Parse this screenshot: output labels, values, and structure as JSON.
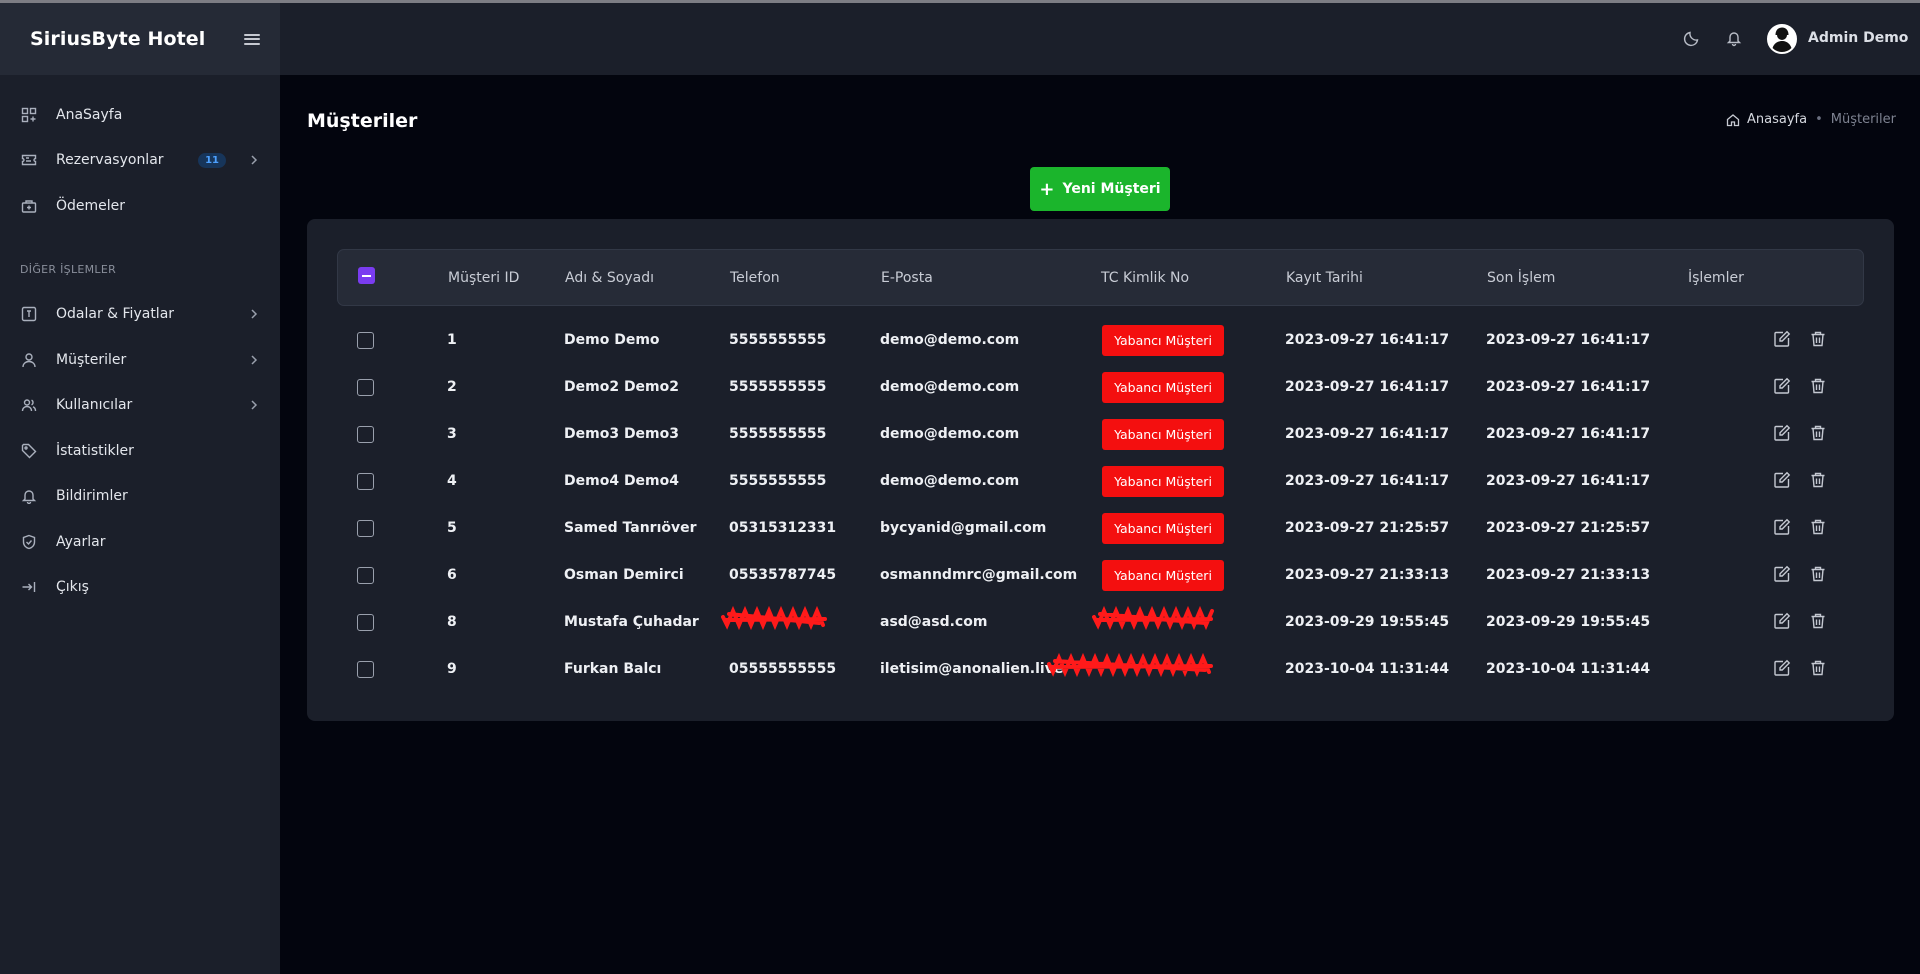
{
  "app": {
    "brand": "SiriusByte Hotel"
  },
  "sidebar": {
    "main_items": [
      {
        "label": "AnaSayfa",
        "icon": "dashboard-icon"
      },
      {
        "label": "Rezervasyonlar",
        "icon": "ticket-icon",
        "badge": "11",
        "has_submenu": true
      },
      {
        "label": "Ödemeler",
        "icon": "wallet-icon"
      }
    ],
    "section_title": "DİĞER İŞLEMLER",
    "other_items": [
      {
        "label": "Odalar & Fiyatlar",
        "icon": "room-icon",
        "has_submenu": true
      },
      {
        "label": "Müşteriler",
        "icon": "user-icon",
        "has_submenu": true
      },
      {
        "label": "Kullanıcılar",
        "icon": "users-icon",
        "has_submenu": true
      },
      {
        "label": "İstatistikler",
        "icon": "tag-icon"
      },
      {
        "label": "Bildirimler",
        "icon": "bell-icon"
      },
      {
        "label": "Ayarlar",
        "icon": "shield-icon"
      },
      {
        "label": "Çıkış",
        "icon": "logout-icon"
      }
    ]
  },
  "header": {
    "user_name": "Admin Demo"
  },
  "page": {
    "title": "Müşteriler",
    "breadcrumb": {
      "home": "Anasayfa",
      "separator": "•",
      "current": "Müşteriler"
    },
    "new_button": "Yeni Müşteri"
  },
  "table": {
    "columns": [
      "Müşteri ID",
      "Adı & Soyadı",
      "Telefon",
      "E-Posta",
      "TC Kimlik No",
      "Kayıt Tarihi",
      "Son İşlem",
      "İşlemler"
    ],
    "rows": [
      {
        "id": "1",
        "name": "Demo Demo",
        "phone": "5555555555",
        "email": "demo@demo.com",
        "tc": "Yabancı Müşteri",
        "created": "2023-09-27 16:41:17",
        "last": "2023-09-27 16:41:17"
      },
      {
        "id": "2",
        "name": "Demo2 Demo2",
        "phone": "5555555555",
        "email": "demo@demo.com",
        "tc": "Yabancı Müşteri",
        "created": "2023-09-27 16:41:17",
        "last": "2023-09-27 16:41:17"
      },
      {
        "id": "3",
        "name": "Demo3 Demo3",
        "phone": "5555555555",
        "email": "demo@demo.com",
        "tc": "Yabancı Müşteri",
        "created": "2023-09-27 16:41:17",
        "last": "2023-09-27 16:41:17"
      },
      {
        "id": "4",
        "name": "Demo4 Demo4",
        "phone": "5555555555",
        "email": "demo@demo.com",
        "tc": "Yabancı Müşteri",
        "created": "2023-09-27 16:41:17",
        "last": "2023-09-27 16:41:17"
      },
      {
        "id": "5",
        "name": "Samed Tanrıöver",
        "phone": "05315312331",
        "email": "bycyanid@gmail.com",
        "tc": "Yabancı Müşteri",
        "created": "2023-09-27 21:25:57",
        "last": "2023-09-27 21:25:57"
      },
      {
        "id": "6",
        "name": "Osman Demirci",
        "phone": "05535787745",
        "email": "osmanndmrc@gmail.com",
        "tc": "Yabancı Müşteri",
        "created": "2023-09-27 21:33:13",
        "last": "2023-09-27 21:33:13"
      },
      {
        "id": "8",
        "name": "Mustafa Çuhadar",
        "phone": "",
        "email": "asd@asd.com",
        "tc": "",
        "created": "2023-09-29 19:55:45",
        "last": "2023-09-29 19:55:45"
      },
      {
        "id": "9",
        "name": "Furkan Balcı",
        "phone": "05555555555",
        "email": "iletisim@anonalien.live",
        "tc": "",
        "created": "2023-10-04 11:31:44",
        "last": "2023-10-04 11:31:44"
      }
    ]
  },
  "colors": {
    "accent_green": "#1bb52c",
    "badge_red": "#f40f0f",
    "checkbox_purple": "#7a3cf0",
    "redaction_red": "#ff1a1a"
  }
}
